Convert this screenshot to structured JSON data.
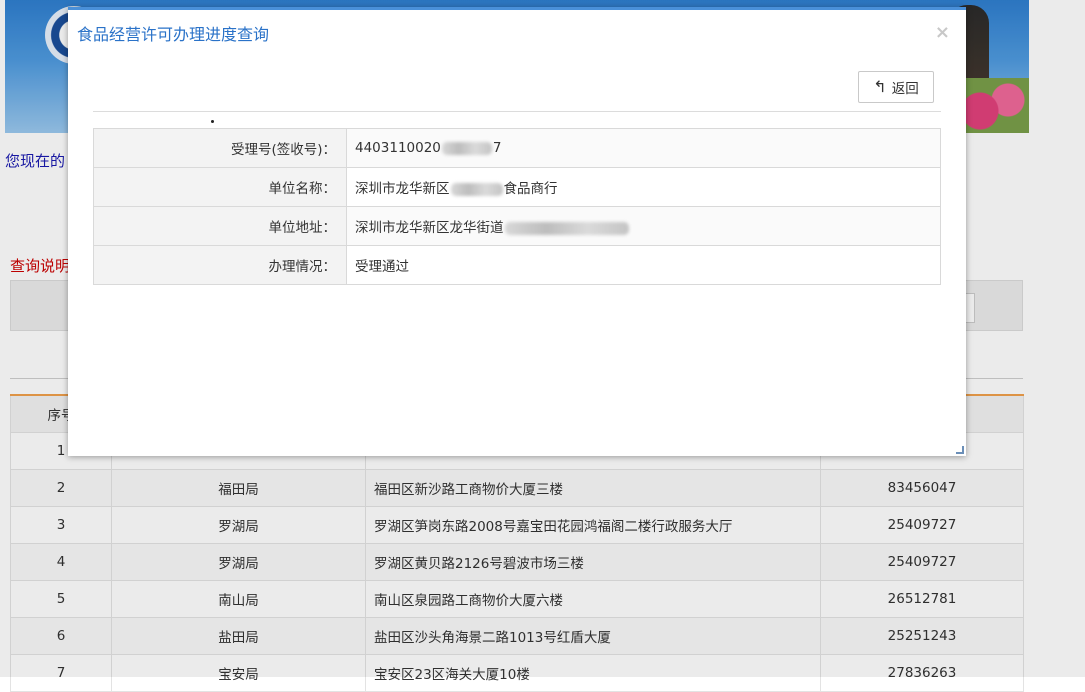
{
  "background": {
    "location_prefix": "您现在的",
    "query_note": "查询说明",
    "table": {
      "headers": [
        "序号",
        "",
        "",
        ""
      ],
      "rows": [
        {
          "no": "1",
          "bureau": "",
          "address": "",
          "phone": ""
        },
        {
          "no": "2",
          "bureau": "福田局",
          "address": "福田区新沙路工商物价大厦三楼",
          "phone": "83456047"
        },
        {
          "no": "3",
          "bureau": "罗湖局",
          "address": "罗湖区笋岗东路2008号嘉宝田花园鸿福阁二楼行政服务大厅",
          "phone": "25409727"
        },
        {
          "no": "4",
          "bureau": "罗湖局",
          "address": "罗湖区黄贝路2126号碧波市场三楼",
          "phone": "25409727"
        },
        {
          "no": "5",
          "bureau": "南山局",
          "address": "南山区泉园路工商物价大厦六楼",
          "phone": "26512781"
        },
        {
          "no": "6",
          "bureau": "盐田局",
          "address": "盐田区沙头角海景二路1013号红盾大厦",
          "phone": "25251243"
        },
        {
          "no": "7",
          "bureau": "宝安局",
          "address": "宝安区23区海关大厦10楼",
          "phone": "27836263"
        }
      ]
    }
  },
  "modal": {
    "title": "食品经营许可办理进度查询",
    "close_symbol": "×",
    "back_label": "返回",
    "back_icon": "reply-arrow-icon",
    "details": [
      {
        "label": "受理号(签收号)：",
        "value_prefix": "4403110020",
        "value_suffix": "7"
      },
      {
        "label": "单位名称：",
        "value_prefix": "深圳市龙华新区",
        "value_suffix": "食品商行"
      },
      {
        "label": "单位地址：",
        "value_prefix": "深圳市龙华新区龙华街道",
        "value_suffix": ""
      },
      {
        "label": "办理情况：",
        "value_prefix": "受理通过",
        "value_suffix": ""
      }
    ]
  },
  "colors": {
    "title_blue": "#2a72c8",
    "modal_border": "#4a90d9",
    "note_red": "#cc0000",
    "header_accent": "#f0a04b"
  }
}
